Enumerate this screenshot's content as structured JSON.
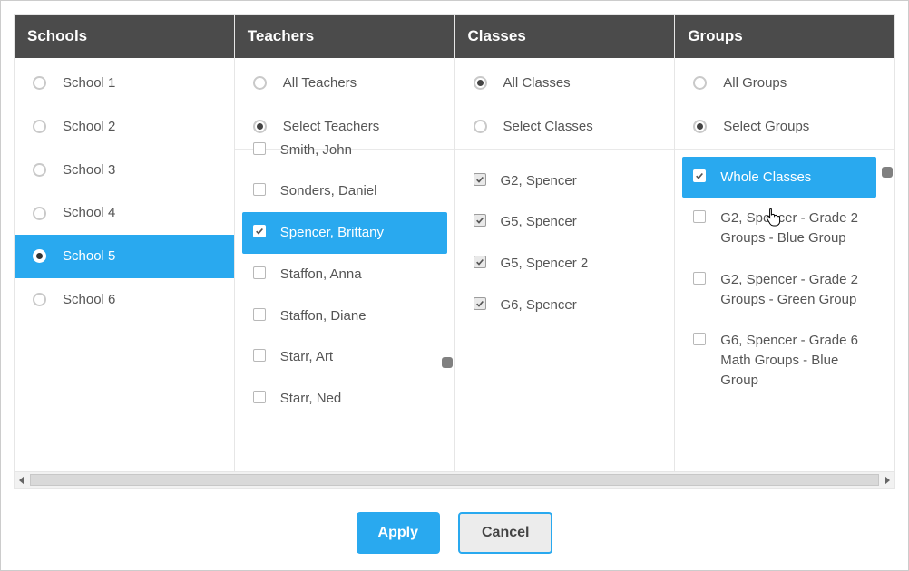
{
  "columns": {
    "schools": {
      "header": "Schools",
      "items": [
        {
          "label": "School 1",
          "selected": false
        },
        {
          "label": "School 2",
          "selected": false
        },
        {
          "label": "School 3",
          "selected": false
        },
        {
          "label": "School 4",
          "selected": false
        },
        {
          "label": "School 5",
          "selected": true,
          "highlight": true
        },
        {
          "label": "School 6",
          "selected": false
        }
      ]
    },
    "teachers": {
      "header": "Teachers",
      "modes": [
        {
          "label": "All Teachers",
          "selected": false
        },
        {
          "label": "Select Teachers",
          "selected": true
        }
      ],
      "items": [
        {
          "label": "Smith, John",
          "checked": false,
          "clipped": true
        },
        {
          "label": "Sonders, Daniel",
          "checked": false
        },
        {
          "label": "Spencer, Brittany",
          "checked": true,
          "highlight": true
        },
        {
          "label": "Staffon, Anna",
          "checked": false
        },
        {
          "label": "Staffon, Diane",
          "checked": false
        },
        {
          "label": "Starr, Art",
          "checked": false
        },
        {
          "label": "Starr, Ned",
          "checked": false
        }
      ]
    },
    "classes": {
      "header": "Classes",
      "modes": [
        {
          "label": "All Classes",
          "selected": true
        },
        {
          "label": "Select Classes",
          "selected": false
        }
      ],
      "items": [
        {
          "label": "G2, Spencer",
          "checked": true
        },
        {
          "label": "G5, Spencer",
          "checked": true
        },
        {
          "label": "G5, Spencer 2",
          "checked": true
        },
        {
          "label": "G6, Spencer",
          "checked": true
        }
      ]
    },
    "groups": {
      "header": "Groups",
      "modes": [
        {
          "label": "All Groups",
          "selected": false
        },
        {
          "label": "Select Groups",
          "selected": true
        }
      ],
      "items": [
        {
          "label": "Whole Classes",
          "checked": true,
          "highlight": true
        },
        {
          "label": "G2, Spencer - Grade 2 Groups - Blue Group",
          "checked": false
        },
        {
          "label": "G2, Spencer - Grade 2 Groups - Green Group",
          "checked": false
        },
        {
          "label": "G6, Spencer - Grade 6 Math Groups - Blue Group",
          "checked": false
        }
      ]
    }
  },
  "footer": {
    "apply_label": "Apply",
    "cancel_label": "Cancel"
  }
}
